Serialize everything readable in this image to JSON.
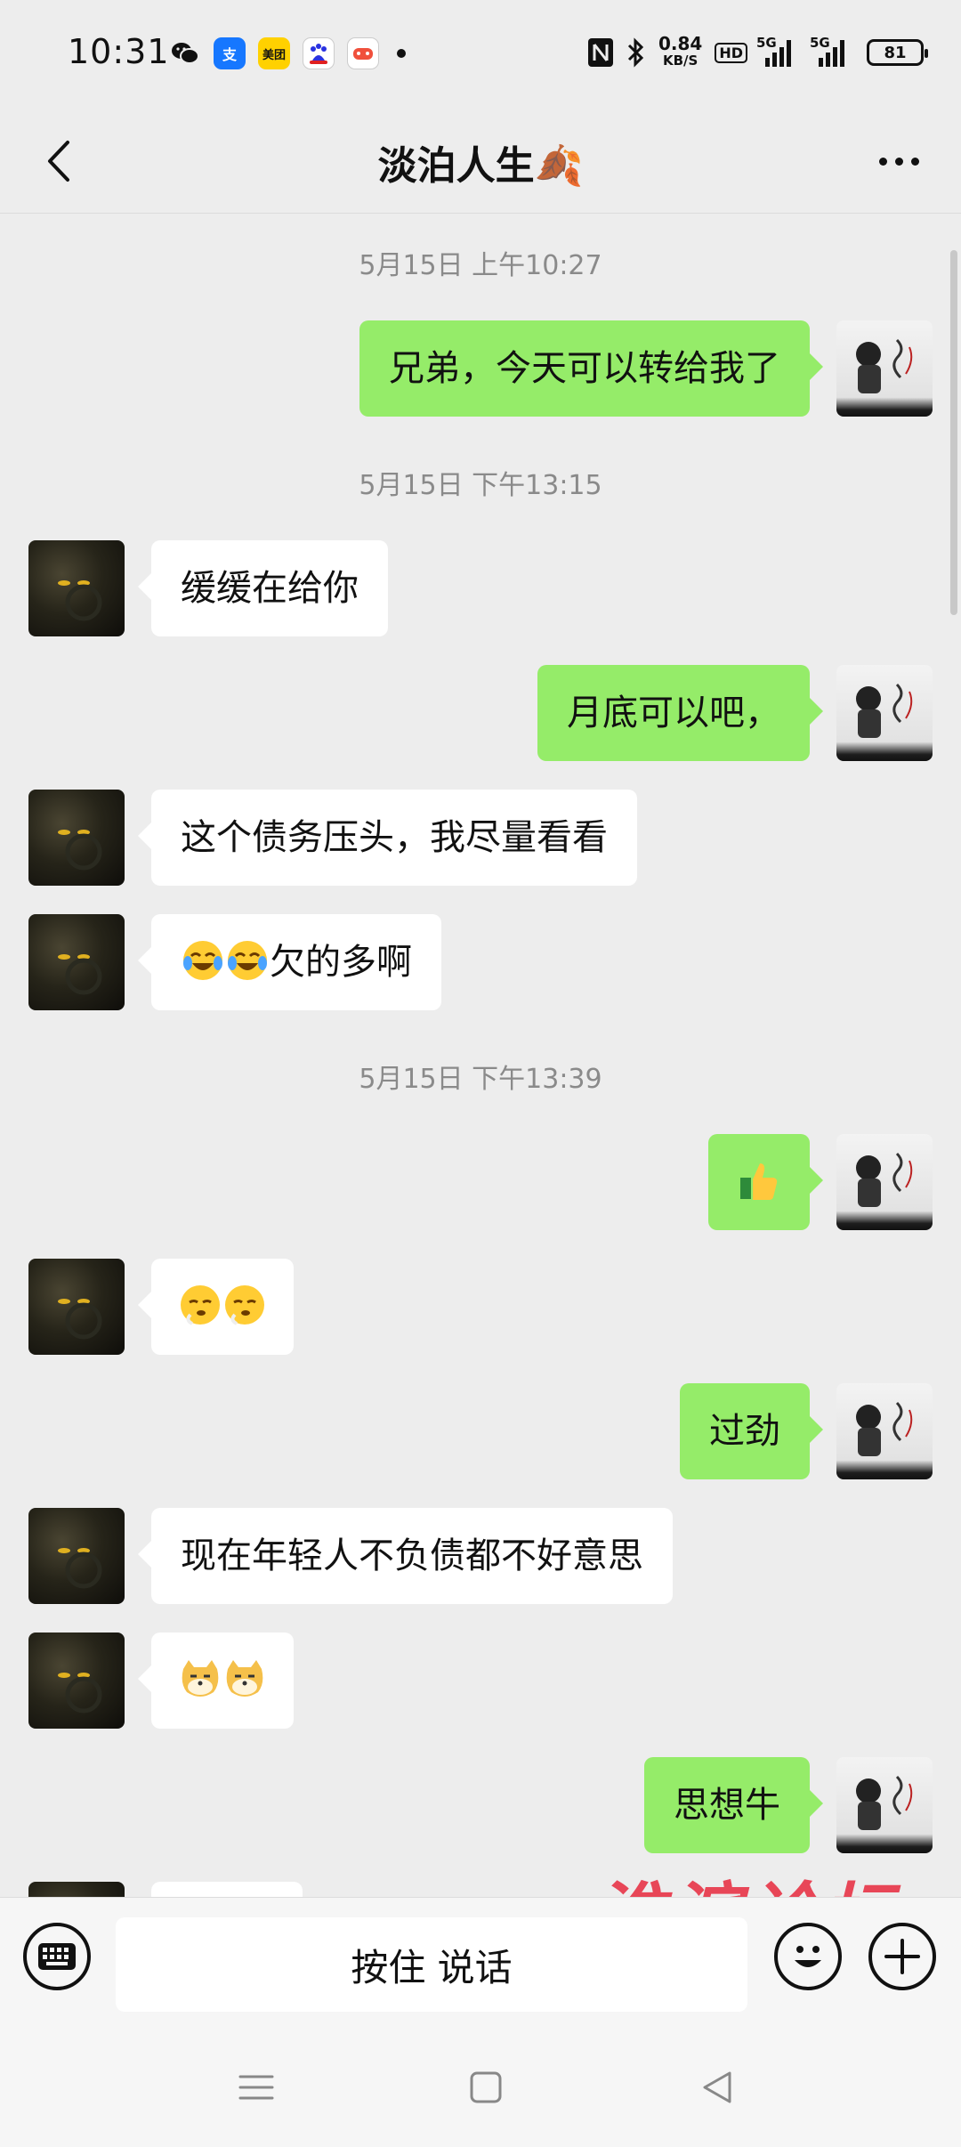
{
  "status_bar": {
    "time": "10:31",
    "apps": [
      "wechat-icon",
      "alipay-icon",
      "meituan-icon",
      "baidu-icon",
      "game-icon"
    ],
    "alipay_glyph": "支",
    "meituan_label": "美团",
    "net_speed_value": "0.84",
    "net_speed_unit": "KB/S",
    "hd_label": "HD",
    "signal_label_1": "5G",
    "signal_label_2": "5G",
    "battery": "81"
  },
  "header": {
    "title": "淡泊人生🍂"
  },
  "chat": {
    "timestamps": [
      "5月15日 上午10:27",
      "5月15日 下午13:15",
      "5月15日 下午13:39"
    ],
    "messages": [
      {
        "sender": "me",
        "text": "兄弟，今天可以转给我了"
      },
      {
        "sender": "them",
        "text": "缓缓在给你"
      },
      {
        "sender": "me",
        "text": "月底可以吧，"
      },
      {
        "sender": "them",
        "text": "这个债务压头，我尽量看看"
      },
      {
        "sender": "them",
        "text": "欠的多啊",
        "emoji_prefix": "tears-of-joy"
      },
      {
        "sender": "me",
        "text": "",
        "emoji": "thumbs-up"
      },
      {
        "sender": "them",
        "text": "",
        "emoji": "sigh"
      },
      {
        "sender": "me",
        "text": "过劲"
      },
      {
        "sender": "them",
        "text": "现在年轻人不负债都不好意思"
      },
      {
        "sender": "them",
        "text": "",
        "emoji": "doge"
      },
      {
        "sender": "me",
        "text": "思想牛"
      }
    ]
  },
  "input_bar": {
    "hold_to_talk": "按住 说话",
    "watermark": "淮滨论坛"
  },
  "colors": {
    "my_bubble": "#95ec69",
    "their_bubble": "#ffffff",
    "background": "#ededed"
  }
}
